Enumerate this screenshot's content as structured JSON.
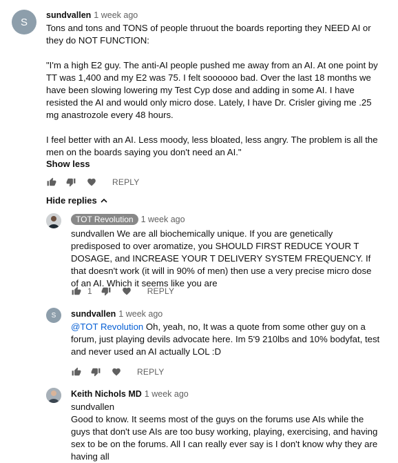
{
  "comment": {
    "avatar_letter": "S",
    "author": "sundvallen",
    "time": "1 week ago",
    "paragraphs": [
      "Tons and tons and TONS of people thruout the boards reporting they NEED AI or they do NOT FUNCTION:",
      "\"I'm a high E2 guy. The anti-AI people pushed me away from an AI. At one point by TT was 1,400 and my E2 was 75. I felt soooooo bad. Over the last 18 months we have been slowing lowering my Test Cyp dose and adding in some AI. I have resisted the AI and would only micro dose. Lately, I have Dr. Crisler giving me .25 mg anastrozole every 48 hours.",
      "I feel better with an AI. Less moody, less bloated, less angry. The problem is all the men on the boards saying you don't need an AI.\""
    ],
    "show_less": "Show less",
    "reply_label": "REPLY",
    "hide_replies": "Hide replies"
  },
  "replies": [
    {
      "author": "TOT Revolution",
      "author_badge": true,
      "time": "1 week ago",
      "text": "sundvallen We are all biochemically unique. If you are genetically predisposed to over aromatize, you SHOULD FIRST REDUCE YOUR T DOSAGE, and INCREASE YOUR T DELIVERY SYSTEM FREQUENCY. If that doesn't work (it will in 90% of men) then use a very precise micro dose of an AI. Which it seems like you are",
      "like_count": "1",
      "reply_label": "REPLY"
    },
    {
      "avatar_letter": "S",
      "author": "sundvallen",
      "time": "1 week ago",
      "mention": "@TOT Revolution",
      "text": " Oh, yeah, no, It was a quote from some other guy on a forum, just playing devils advocate here. Im 5'9 210lbs and 10% bodyfat, test and never used an AI actually LOL :D",
      "reply_label": "REPLY"
    },
    {
      "author": "Keith Nichols MD",
      "time": "1 week ago",
      "line1": "sundvallen",
      "text": "Good to know. It seems most of the guys on the forums use AIs while the guys that don't use AIs  are too busy working, playing, exercising, and having sex to be on the forums. All I can really ever say is I don't know why they are having all"
    }
  ],
  "icons": {
    "like": "thumbs-up-icon",
    "dislike": "thumbs-down-icon",
    "heart": "heart-icon",
    "caret": "chevron-up-icon"
  }
}
